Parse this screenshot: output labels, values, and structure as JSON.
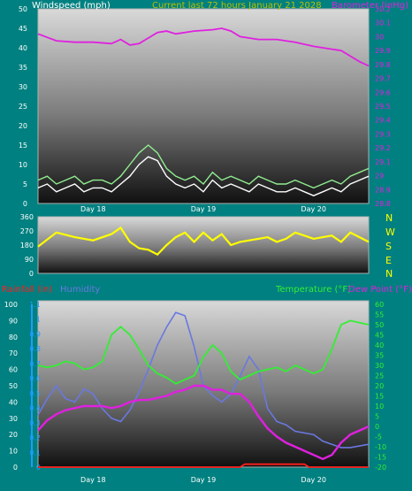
{
  "colors": {
    "background": "#008080",
    "wind_avg": "#ffffff",
    "wind_gust": "#90ee90",
    "barometer": "#e020e0",
    "wind_dir": "#ffff00",
    "compass": "#ffff00",
    "rainfall": "#ff1e1e",
    "humidity": "#6a78e0",
    "temperature": "#33ee33",
    "dew_point": "#e020e0",
    "rain_axis": "#1e9bff"
  },
  "chart_data": [
    {
      "type": "line",
      "header": "Current last 72 hours January 21 2028",
      "ylabel_left": "Windspeed (mph)",
      "ylabel_right": "Barometer (inHg)",
      "yticks_left": [
        "0",
        "5",
        "10",
        "15",
        "20",
        "25",
        "30",
        "35",
        "40",
        "45",
        "50"
      ],
      "yticks_right": [
        "28.8",
        "28.9",
        "29",
        "29.1",
        "29.2",
        "29.3",
        "29.4",
        "29.5",
        "29.6",
        "29.7",
        "29.8",
        "29.9",
        "30",
        "30.1",
        "30.2"
      ],
      "xticks": [
        "Day 18",
        "Day 19",
        "Day 20"
      ],
      "ylim_left": [
        0,
        50
      ],
      "ylim_right": [
        28.8,
        30.2
      ],
      "xlim": [
        0,
        72
      ],
      "series": [
        {
          "name": "Barometer",
          "axis": "right",
          "x": [
            0,
            4,
            8,
            12,
            16,
            18,
            20,
            22,
            24,
            26,
            28,
            30,
            34,
            38,
            40,
            42,
            44,
            48,
            52,
            56,
            60,
            64,
            66,
            68,
            70,
            72
          ],
          "values": [
            30.02,
            29.97,
            29.96,
            29.96,
            29.95,
            29.98,
            29.94,
            29.95,
            29.99,
            30.03,
            30.04,
            30.02,
            30.04,
            30.05,
            30.06,
            30.04,
            30.0,
            29.98,
            29.98,
            29.96,
            29.93,
            29.91,
            29.9,
            29.86,
            29.82,
            29.79
          ]
        },
        {
          "name": "Windspeed",
          "axis": "left",
          "x": [
            0,
            2,
            4,
            6,
            8,
            10,
            12,
            14,
            16,
            18,
            20,
            22,
            24,
            26,
            28,
            30,
            32,
            34,
            36,
            38,
            40,
            42,
            44,
            46,
            48,
            50,
            52,
            54,
            56,
            58,
            60,
            62,
            64,
            66,
            68,
            70,
            72
          ],
          "values": [
            4,
            5,
            3,
            4,
            5,
            3,
            4,
            4,
            3,
            5,
            7,
            10,
            12,
            11,
            7,
            5,
            4,
            5,
            3,
            6,
            4,
            5,
            4,
            3,
            5,
            4,
            3,
            3,
            4,
            3,
            2,
            3,
            4,
            3,
            5,
            6,
            7
          ]
        },
        {
          "name": "Wind gust",
          "axis": "left",
          "x": [
            0,
            2,
            4,
            6,
            8,
            10,
            12,
            14,
            16,
            18,
            20,
            22,
            24,
            26,
            28,
            30,
            32,
            34,
            36,
            38,
            40,
            42,
            44,
            46,
            48,
            50,
            52,
            54,
            56,
            58,
            60,
            62,
            64,
            66,
            68,
            70,
            72
          ],
          "values": [
            6,
            7,
            5,
            6,
            7,
            5,
            6,
            6,
            5,
            7,
            10,
            13,
            15,
            13,
            9,
            7,
            6,
            7,
            5,
            8,
            6,
            7,
            6,
            5,
            7,
            6,
            5,
            5,
            6,
            5,
            4,
            5,
            6,
            5,
            7,
            8,
            9
          ]
        }
      ]
    },
    {
      "type": "line",
      "xlabel": "",
      "yticks_left": [
        "0",
        "90",
        "180",
        "270",
        "360"
      ],
      "compass": [
        "N",
        "W",
        "S",
        "E",
        "N"
      ],
      "xticks": [
        "Day 18",
        "Day 19",
        "Day 20"
      ],
      "ylim": [
        0,
        360
      ],
      "xlim": [
        0,
        72
      ],
      "series": [
        {
          "name": "Wind direction",
          "x": [
            0,
            4,
            8,
            12,
            16,
            18,
            20,
            22,
            24,
            26,
            28,
            30,
            32,
            34,
            36,
            38,
            40,
            42,
            44,
            46,
            48,
            50,
            52,
            54,
            56,
            58,
            60,
            62,
            64,
            66,
            68,
            70,
            72
          ],
          "values": [
            170,
            260,
            230,
            210,
            250,
            290,
            200,
            160,
            150,
            120,
            180,
            230,
            260,
            200,
            260,
            210,
            250,
            180,
            200,
            210,
            220,
            230,
            200,
            220,
            260,
            240,
            220,
            230,
            240,
            200,
            260,
            230,
            200
          ]
        }
      ]
    },
    {
      "type": "line",
      "ylabel_left": "Rainfall (in)",
      "ylabel_left2": "Humidity",
      "ylabel_right": "Temperature (°F)",
      "ylabel_right2": "Dew Point (°F)",
      "yticks_humidity": [
        "0",
        "10",
        "20",
        "30",
        "40",
        "50",
        "60",
        "70",
        "80",
        "90",
        "100"
      ],
      "yticks_rain": [
        "0",
        "0.1",
        "0.2",
        "0.3",
        "0.4",
        "0.5",
        "0.6",
        "0.7",
        "0.8",
        "0.9",
        "1",
        "1.1"
      ],
      "yticks_right": [
        "-20",
        "-15",
        "-10",
        "-5",
        "0",
        "5",
        "10",
        "15",
        "20",
        "25",
        "30",
        "35",
        "40",
        "45",
        "50",
        "55",
        "60"
      ],
      "xticks": [
        "Day 18",
        "Day 19",
        "Day 20"
      ],
      "ylim_humidity": [
        0,
        100
      ],
      "ylim_rain": [
        0,
        1.1
      ],
      "ylim_right": [
        -20,
        60
      ],
      "xlim": [
        0,
        72
      ],
      "series": [
        {
          "name": "Rainfall",
          "axis": "rain",
          "x": [
            0,
            44,
            45,
            58,
            59,
            72
          ],
          "values": [
            0,
            0,
            0.02,
            0.02,
            0,
            0
          ]
        },
        {
          "name": "Humidity",
          "axis": "humidity",
          "x": [
            0,
            2,
            4,
            6,
            8,
            10,
            12,
            14,
            16,
            18,
            20,
            22,
            24,
            26,
            28,
            30,
            32,
            34,
            36,
            38,
            40,
            42,
            44,
            46,
            48,
            50,
            52,
            54,
            56,
            58,
            60,
            62,
            64,
            66,
            68,
            70,
            72
          ],
          "values": [
            32,
            42,
            50,
            42,
            40,
            48,
            45,
            36,
            30,
            28,
            35,
            46,
            60,
            75,
            86,
            95,
            93,
            74,
            50,
            44,
            40,
            45,
            56,
            68,
            60,
            36,
            28,
            26,
            22,
            21,
            20,
            16,
            14,
            12,
            12,
            13,
            14
          ]
        },
        {
          "name": "Temperature",
          "axis": "right",
          "x": [
            0,
            2,
            4,
            6,
            8,
            10,
            12,
            14,
            16,
            18,
            20,
            22,
            24,
            26,
            28,
            30,
            32,
            34,
            36,
            38,
            40,
            42,
            44,
            46,
            48,
            50,
            52,
            54,
            56,
            58,
            60,
            62,
            64,
            66,
            68,
            70,
            72
          ],
          "values": [
            30,
            29,
            30,
            32,
            31,
            28,
            29,
            32,
            45,
            49,
            45,
            38,
            30,
            26,
            24,
            21,
            23,
            25,
            34,
            40,
            36,
            27,
            23,
            25,
            27,
            28,
            29,
            27,
            30,
            28,
            26,
            28,
            38,
            50,
            52,
            51,
            50
          ]
        },
        {
          "name": "Dew Point",
          "axis": "right",
          "x": [
            0,
            2,
            4,
            6,
            8,
            10,
            12,
            14,
            16,
            18,
            20,
            22,
            24,
            26,
            28,
            30,
            32,
            34,
            36,
            38,
            40,
            42,
            44,
            46,
            48,
            50,
            52,
            54,
            56,
            58,
            60,
            62,
            64,
            66,
            68,
            70,
            72
          ],
          "values": [
            -2,
            3,
            6,
            8,
            9,
            10,
            10,
            10,
            9,
            10,
            12,
            13,
            13,
            14,
            15,
            17,
            18,
            20,
            20,
            18,
            18,
            16,
            16,
            12,
            5,
            -1,
            -5,
            -8,
            -10,
            -12,
            -14,
            -16,
            -14,
            -8,
            -4,
            -2,
            0
          ]
        }
      ]
    }
  ]
}
